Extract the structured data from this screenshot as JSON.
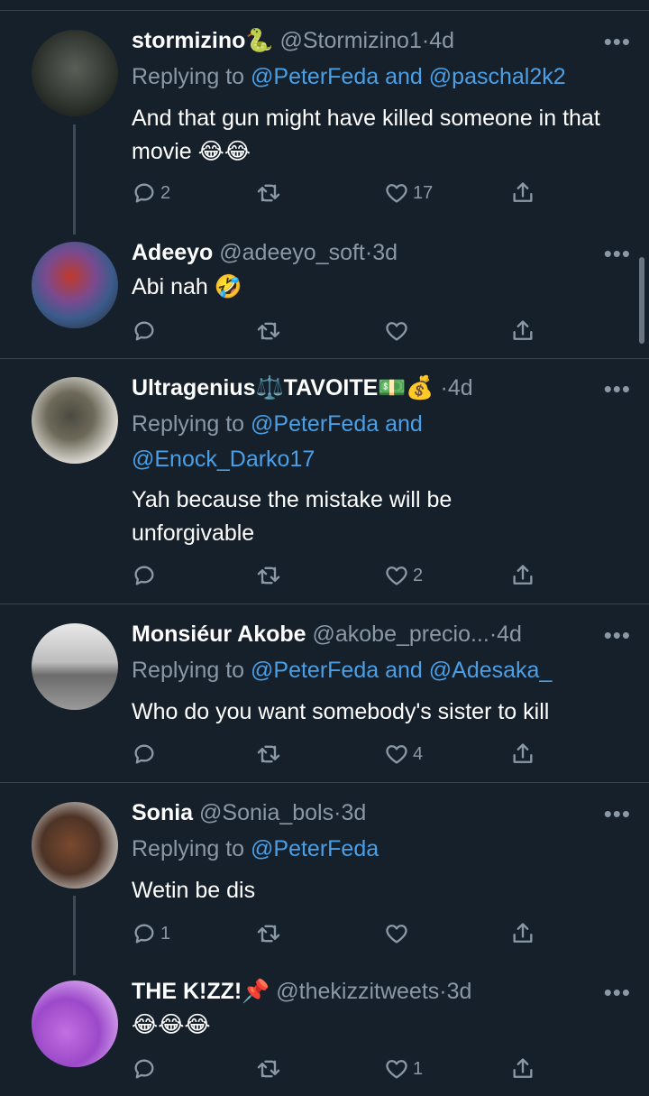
{
  "tweets": [
    {
      "name": "stormizino🐍",
      "handle": "@Stormizino1",
      "sep": "·",
      "time": "4d",
      "reply_prefix": "Replying to",
      "mention1": "@PeterFeda",
      "mention_and": "and",
      "mention2": "@paschal2k2",
      "text": "And that gun might have killed someone in that movie 😂😂",
      "replies": "2",
      "retweets": "",
      "likes": "17"
    },
    {
      "name": "Adeeyo",
      "handle": "@adeeyo_soft",
      "sep": "·",
      "time": "3d",
      "text": "Abi nah 🤣",
      "replies": "",
      "retweets": "",
      "likes": ""
    },
    {
      "name": "Ultragenius⚖️TAVOITE💵💰",
      "handle": "",
      "sep": "·",
      "time": "4d",
      "reply_prefix": "Replying to",
      "mention1": "@PeterFeda",
      "mention_and": "and",
      "mention2": "@Enock_Darko17",
      "text": "Yah because the mistake will be unforgivable",
      "replies": "",
      "retweets": "",
      "likes": "2"
    },
    {
      "name": "Monsiéur Akobe",
      "handle": "@akobe_precio...",
      "sep": "·",
      "time": "4d",
      "reply_prefix": "Replying to",
      "mention1": "@PeterFeda",
      "mention_and": "and",
      "mention2": "@Adesaka_",
      "text": "Who do you want somebody's sister to kill",
      "replies": "",
      "retweets": "",
      "likes": "4"
    },
    {
      "name": "Sonia",
      "handle": "@Sonia_bols",
      "sep": "·",
      "time": "3d",
      "reply_prefix": "Replying to",
      "mention1": "@PeterFeda",
      "text": "Wetin be dis",
      "replies": "1",
      "retweets": "",
      "likes": ""
    },
    {
      "name": "THE K!ZZ!📌",
      "handle": "@thekizzitweets",
      "sep": "·",
      "time": "3d",
      "text": "😂😂😂",
      "replies": "",
      "retweets": "",
      "likes": "1"
    }
  ],
  "more_label": "•••",
  "colors": {
    "background": "#15202b",
    "mention": "#4a9fe6",
    "muted": "#8b98a5",
    "divider": "#38444d"
  }
}
